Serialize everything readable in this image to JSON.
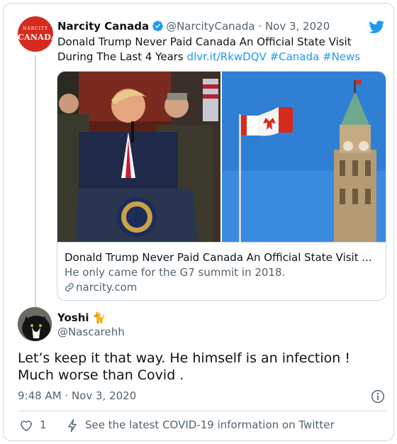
{
  "quoted_tweet": {
    "avatar_small_text": "NARCITY",
    "avatar_big_text": "CANADA",
    "display_name": "Narcity Canada",
    "handle": "@NarcityCanada",
    "separator": "·",
    "date": "Nov 3, 2020",
    "text_line1": "Donald Trump Never Paid Canada An Official State Visit",
    "text_line2_prefix": "During The Last 4 Years",
    "link": "dlvr.it/RkwDQV",
    "hashtag_1": "#Canada",
    "hashtag_2": "#News",
    "link_card": {
      "title": "Donald Trump Never Paid Canada An Official State Visit ...",
      "description": "He only came for the G7 summit in 2018.",
      "domain": "narcity.com"
    }
  },
  "reply_tweet": {
    "display_name": "Yoshi 🐈",
    "handle": "@Nascarehh",
    "text_line1": "Let’s keep it that way. He himself is an infection !",
    "text_line2": "Much worse than Covid .",
    "timestamp": "9:48 AM · Nov 3, 2020"
  },
  "actions": {
    "like_count": "1",
    "covid_info": "See the latest COVID-19 information on Twitter"
  },
  "colors": {
    "accent": "#1d9bf0",
    "secondary_text": "#536471",
    "border": "#cfd9de",
    "avatar_red": "#d52b1e"
  },
  "icons": [
    "twitter-bird-icon",
    "verified-badge-icon",
    "link-icon",
    "info-icon",
    "heart-icon",
    "lightning-icon"
  ]
}
